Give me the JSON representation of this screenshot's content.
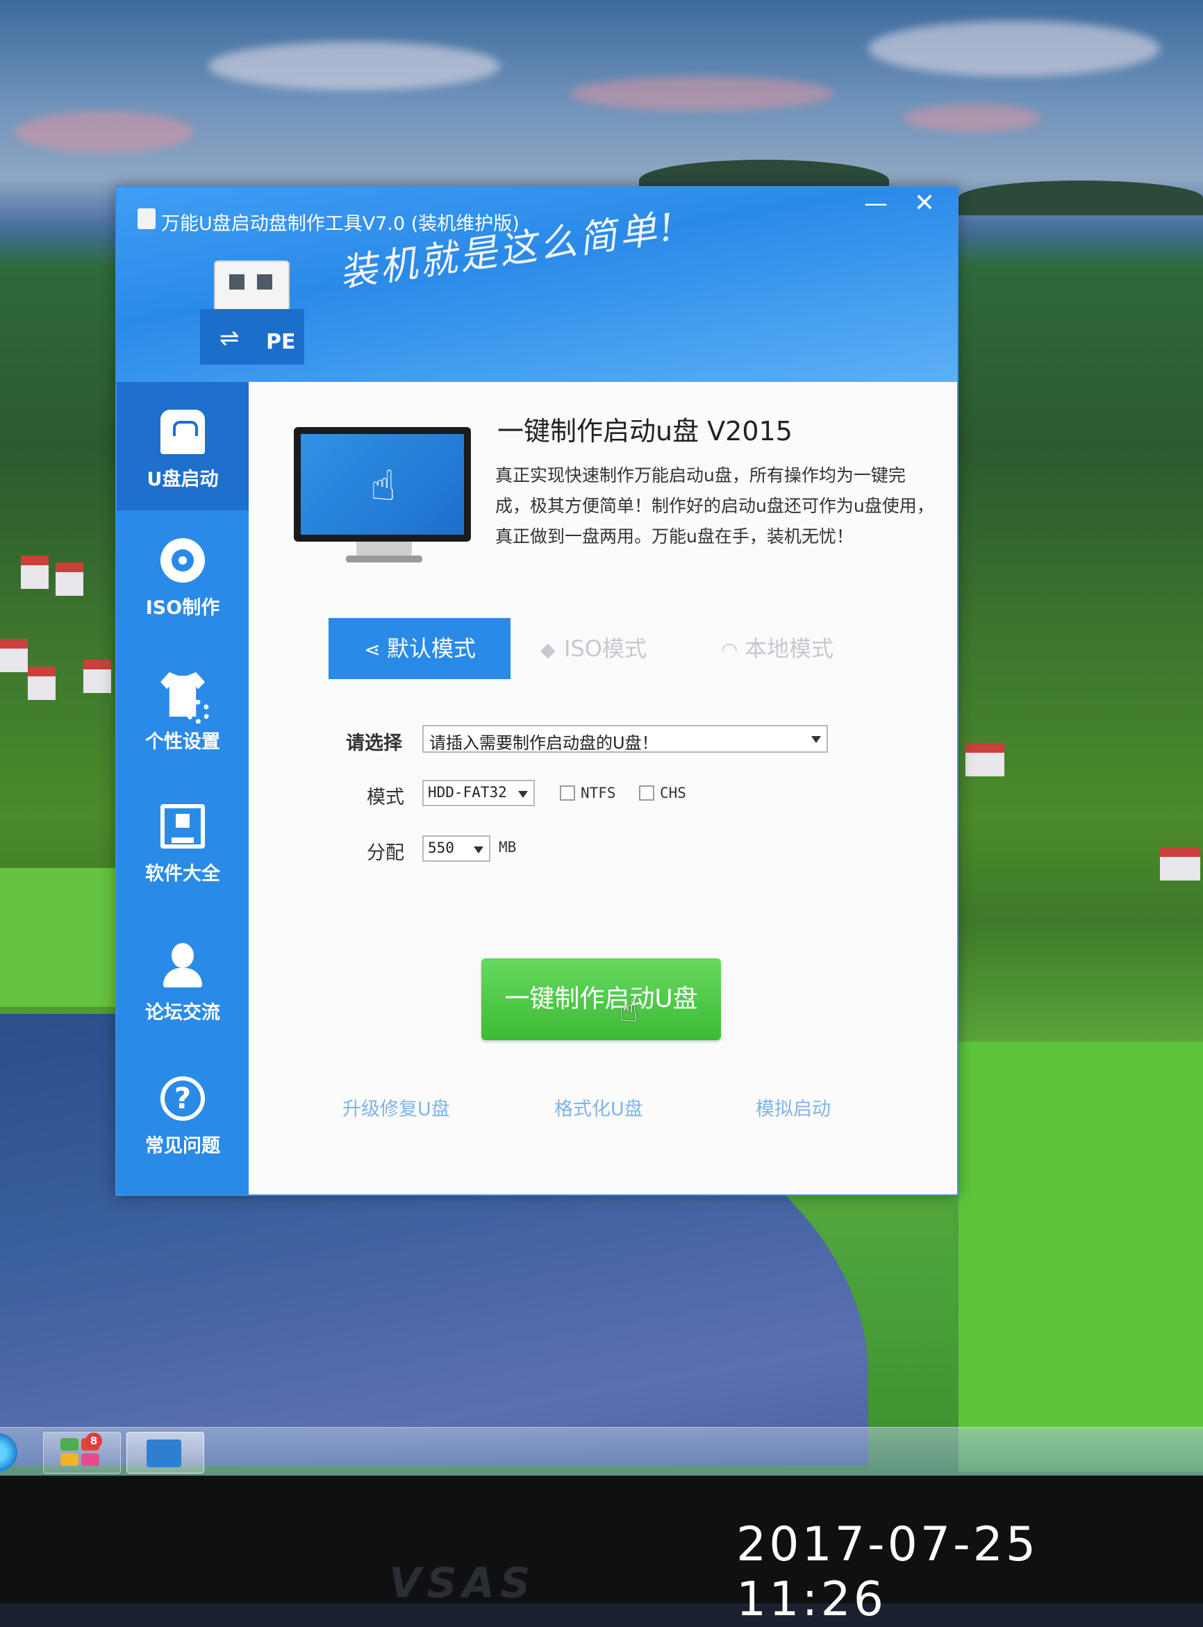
{
  "window": {
    "title": "万能U盘启动盘制作工具V7.0 (装机维护版)",
    "minimize": "—",
    "close": "✕",
    "slogan": "装机就是这么简单!"
  },
  "logo": {
    "badge": "PE"
  },
  "sidebar": {
    "items": [
      {
        "label": "U盘启动",
        "icon": "usb-drive-icon",
        "active": true
      },
      {
        "label": "ISO制作",
        "icon": "disc-icon"
      },
      {
        "label": "个性设置",
        "icon": "shirt-gear-icon"
      },
      {
        "label": "软件大全",
        "icon": "monitor-cube-icon"
      },
      {
        "label": "论坛交流",
        "icon": "user-icon"
      },
      {
        "label": "常见问题",
        "icon": "question-icon"
      }
    ]
  },
  "main": {
    "heading": "一键制作启动u盘 V2015",
    "description": "真正实现快速制作万能启动u盘，所有操作均为一键完成，极其方便简单！制作好的启动u盘还可作为u盘使用，真正做到一盘两用。万能u盘在手，装机无忧！",
    "tabs": [
      {
        "label": "默认模式",
        "icon": "share-icon",
        "active": true
      },
      {
        "label": "ISO模式",
        "icon": "tag-icon"
      },
      {
        "label": "本地模式",
        "icon": "rss-icon"
      }
    ],
    "select_label": "请选择",
    "select_value": "请插入需要制作启动盘的U盘！",
    "mode_label": "模式",
    "mode_value": "HDD-FAT32",
    "ntfs_label": "NTFS",
    "chs_label": "CHS",
    "partition_label": "分配",
    "partition_value": "550",
    "partition_unit": "MB",
    "primary_button": "一键制作启动U盘",
    "links": [
      "升级修复U盘",
      "格式化U盘",
      "模拟启动"
    ]
  },
  "taskbar": {
    "badge_count": "8"
  },
  "photo": {
    "brand": "VSAS",
    "timestamp": "2017-07-25  11:26"
  },
  "colors": {
    "accent": "#2a8ae8",
    "sidebar_active": "#1f6fcc",
    "button_green": "#3dbb35"
  }
}
